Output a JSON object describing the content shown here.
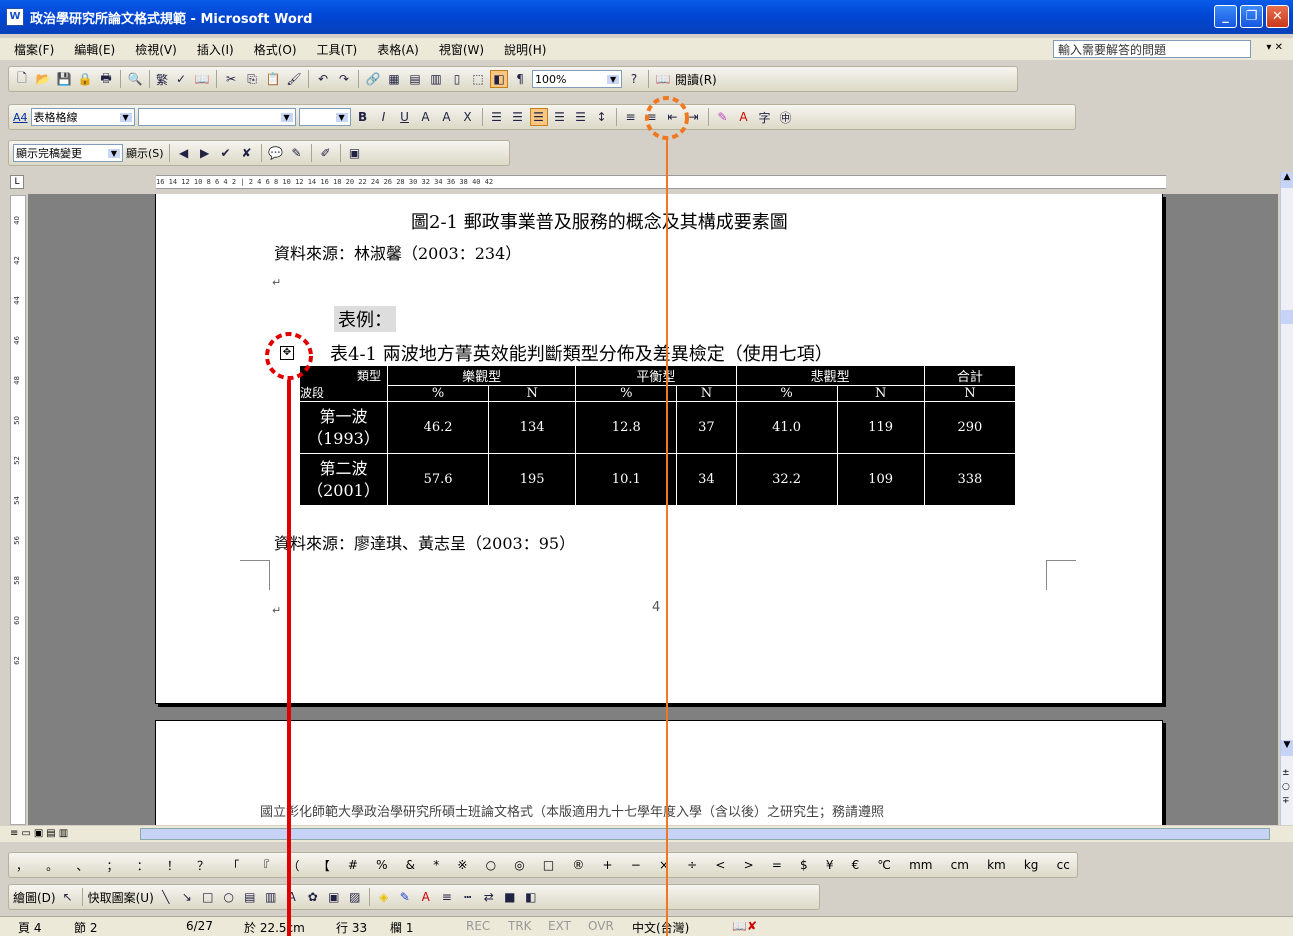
{
  "window": {
    "title": "政治學研究所論文格式規範 - Microsoft Word",
    "icon": "word-icon"
  },
  "menu": {
    "items": [
      "檔案(F)",
      "編輯(E)",
      "檢視(V)",
      "插入(I)",
      "格式(O)",
      "工具(T)",
      "表格(A)",
      "視窗(W)",
      "說明(H)"
    ],
    "help_placeholder": "輸入需要解答的問題"
  },
  "toolbar": {
    "zoom": "100%",
    "read_label": "閱讀(R)",
    "style": "表格格線",
    "style_icon": "A4",
    "review_combo": "顯示完稿變更",
    "show_label": "顯示(S)",
    "trad_label": "繁"
  },
  "doc": {
    "fig_caption": "圖2-1  郵政事業普及服務的概念及其構成要素圖",
    "source1": "資料來源：林淑馨（2003：234）",
    "example_label": "表例：",
    "table_caption": "表4-1  兩波地方菁英效能判斷類型分佈及差異檢定（使用七項）",
    "table": {
      "corner_top": "類型",
      "corner_bottom": "波段",
      "headers": [
        "樂觀型",
        "平衡型",
        "悲觀型",
        "合計"
      ],
      "subheaders": [
        "%",
        "N",
        "%",
        "N",
        "%",
        "N",
        "N"
      ],
      "rows": [
        {
          "label1": "第一波",
          "label2": "（1993）",
          "cells": [
            "46.2",
            "134",
            "12.8",
            "37",
            "41.0",
            "119",
            "290"
          ]
        },
        {
          "label1": "第二波",
          "label2": "（2001）",
          "cells": [
            "57.6",
            "195",
            "10.1",
            "34",
            "32.2",
            "109",
            "338"
          ]
        }
      ]
    },
    "source2": "資料來源：廖達琪、黃志呈（2003：95）",
    "page_number": "4",
    "page2_text": "國立彰化師範大學政治學研究所碩士班論文格式（本版適用九十七學年度入學（含以後）之研究生；務請遵照"
  },
  "symbols": [
    "，",
    "。",
    "、",
    "；",
    "：",
    "！",
    "？",
    "「",
    "『",
    "（",
    "【",
    "#",
    "%",
    "&",
    "*",
    "※",
    "○",
    "◎",
    "□",
    "®",
    "+",
    "−",
    "×",
    "÷",
    "<",
    ">",
    "=",
    "$",
    "¥",
    "€",
    "℃",
    "mm",
    "cm",
    "km",
    "kg",
    "cc"
  ],
  "drawing": {
    "draw_label": "繪圖(D)",
    "autoshape_label": "快取圖案(U)"
  },
  "status": {
    "page": "頁 4",
    "section": "節 2",
    "pages": "6/27",
    "at": "於 22.5cm",
    "line": "行 33",
    "col": "欄 1",
    "rec": "REC",
    "trk": "TRK",
    "ext": "EXT",
    "ovr": "OVR",
    "lang": "中文(台灣)"
  },
  "ruler": {
    "h": "16  14  12  10  8  6  4  2  |  2  4  6  8  10  12  14  16  18  20  22  24  26  28  30  32  34  36  38  40  42",
    "v": [
      "40",
      "42",
      "44",
      "46",
      "48",
      "50",
      "52",
      "54",
      "56",
      "58",
      "60",
      "62"
    ]
  },
  "annotations": {
    "orange": "#f07820",
    "red": "#e00000"
  }
}
